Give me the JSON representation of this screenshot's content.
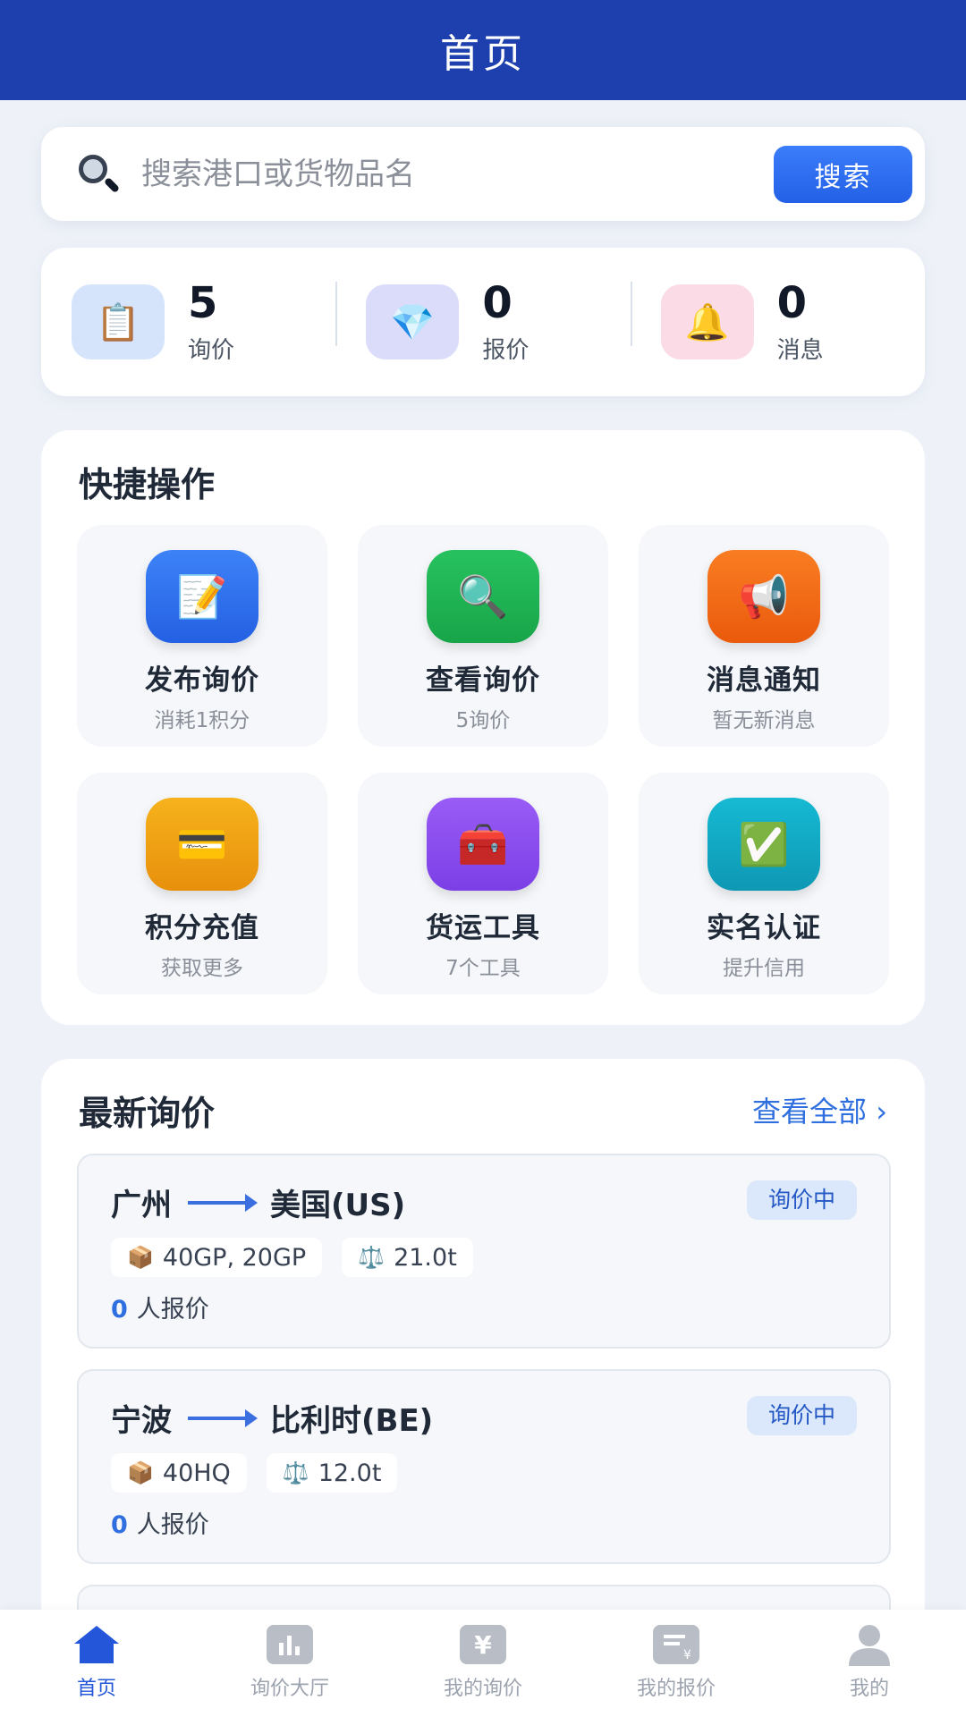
{
  "header": {
    "title": "首页"
  },
  "search": {
    "placeholder": "搜索港口或货物品名",
    "button_label": "搜索"
  },
  "stats": [
    {
      "value": "5",
      "label": "询价",
      "icon": "clipboard-icon"
    },
    {
      "value": "0",
      "label": "报价",
      "icon": "diamond-icon"
    },
    {
      "value": "0",
      "label": "消息",
      "icon": "bell-icon"
    }
  ],
  "quick_actions": {
    "title": "快捷操作",
    "items": [
      {
        "title": "发布询价",
        "subtitle": "消耗1积分",
        "icon": "memo-icon",
        "color": "#2f6fe8"
      },
      {
        "title": "查看询价",
        "subtitle": "5询价",
        "icon": "magnifier-icon",
        "color": "#20b455"
      },
      {
        "title": "消息通知",
        "subtitle": "暂无新消息",
        "icon": "megaphone-icon",
        "color": "#f26b16"
      },
      {
        "title": "积分充值",
        "subtitle": "获取更多",
        "icon": "credit-card-icon",
        "color": "#f0a114"
      },
      {
        "title": "货运工具",
        "subtitle": "7个工具",
        "icon": "toolbox-icon",
        "color": "#8b4ef0"
      },
      {
        "title": "实名认证",
        "subtitle": "提升信用",
        "icon": "check-mark-icon",
        "color": "#13a9c4"
      }
    ]
  },
  "recent": {
    "title": "最新询价",
    "view_all": "查看全部 ›",
    "items": [
      {
        "from": "广州",
        "to": "美国(US)",
        "status": "询价中",
        "containers": "40GP, 20GP",
        "weight": "21.0t",
        "quote_count": "0",
        "quote_suffix": "人报价"
      },
      {
        "from": "宁波",
        "to": "比利时(BE)",
        "status": "询价中",
        "containers": "40HQ",
        "weight": "12.0t",
        "quote_count": "0",
        "quote_suffix": "人报价"
      }
    ]
  },
  "tabbar": [
    {
      "label": "首页",
      "icon": "home-icon",
      "active": true
    },
    {
      "label": "询价大厅",
      "icon": "bar-chart-icon",
      "active": false
    },
    {
      "label": "我的询价",
      "icon": "yen-chat-icon",
      "active": false
    },
    {
      "label": "我的报价",
      "icon": "yen-document-icon",
      "active": false
    },
    {
      "label": "我的",
      "icon": "user-icon",
      "active": false
    }
  ]
}
